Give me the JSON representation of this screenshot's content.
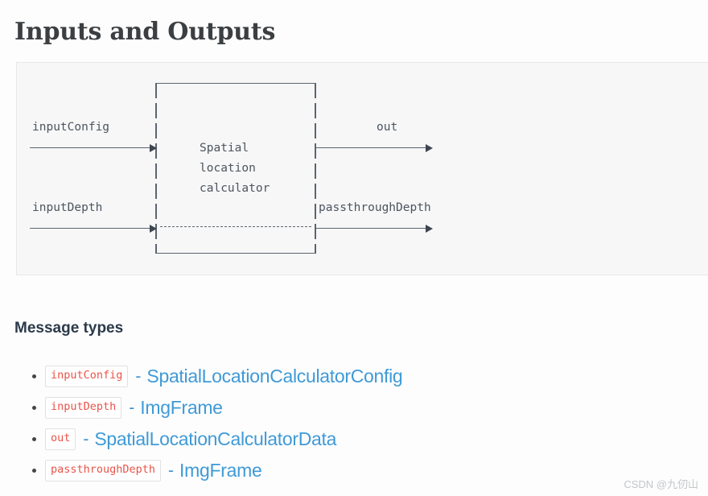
{
  "page": {
    "title": "Inputs and Outputs"
  },
  "diagram": {
    "block_label_lines": [
      "Spatial",
      "location",
      "calculator"
    ],
    "inputs": [
      {
        "name": "inputConfig",
        "arrow": "arrow-right"
      },
      {
        "name": "inputDepth",
        "arrow": "arrow-right"
      }
    ],
    "outputs": [
      {
        "name": "out",
        "arrow": "arrow-right"
      },
      {
        "name": "passthroughDepth",
        "arrow": "arrow-right"
      }
    ]
  },
  "message_types": {
    "heading": "Message types",
    "separator": "-",
    "items": [
      {
        "port": "inputConfig",
        "type": "SpatialLocationCalculatorConfig"
      },
      {
        "port": "inputDepth",
        "type": "ImgFrame"
      },
      {
        "port": "out",
        "type": "SpatialLocationCalculatorData"
      },
      {
        "port": "passthroughDepth",
        "type": "ImgFrame"
      }
    ]
  },
  "watermark": {
    "text": "CSDN @九仞山"
  },
  "colors": {
    "link_blue": "#3f9ad7",
    "code_red": "#e8544a",
    "heading_navy": "#2b3a4a",
    "title_gray": "#3b3f42",
    "diagram_stroke": "#5c6470",
    "panel_bg": "#f7f7f7"
  }
}
